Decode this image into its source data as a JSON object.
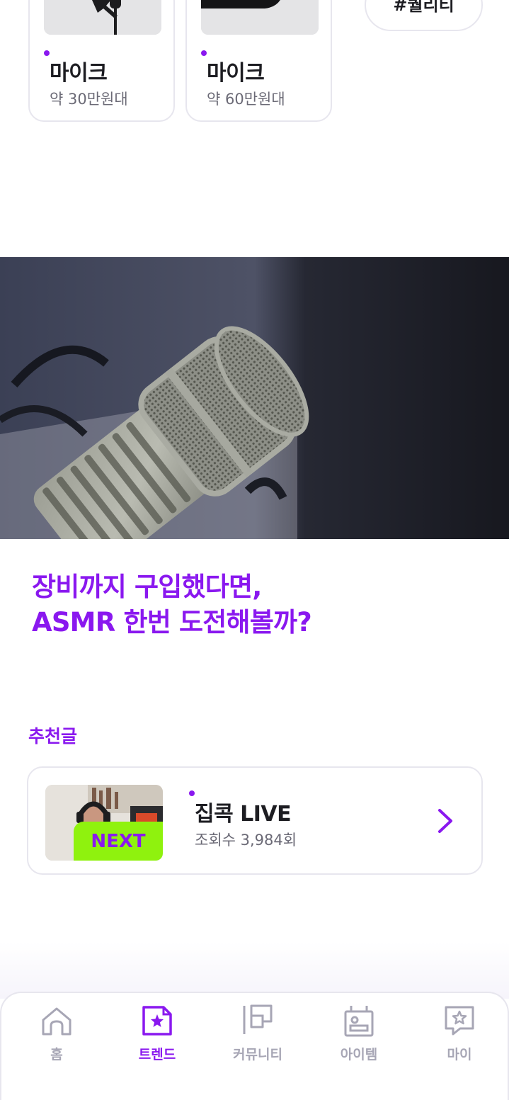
{
  "products": [
    {
      "name": "마이크",
      "price": "약 30만원대"
    },
    {
      "name": "마이크",
      "price": "약 60만원대"
    }
  ],
  "tag_chip": "#퀄리티",
  "hero": {
    "title_line1": "장비까지 구입했다면,",
    "title_line2": "ASMR 한번 도전해볼까?"
  },
  "recommended": {
    "section_label": "추천글",
    "badge": "NEXT",
    "title": "집콕 LIVE",
    "views": "조회수 3,984회"
  },
  "nav": {
    "items": [
      {
        "label": "홈",
        "icon": "home-icon"
      },
      {
        "label": "트렌드",
        "icon": "trend-icon"
      },
      {
        "label": "커뮤니티",
        "icon": "community-icon"
      },
      {
        "label": "아이템",
        "icon": "item-icon"
      },
      {
        "label": "마이",
        "icon": "my-icon"
      }
    ],
    "active": "트렌드"
  },
  "colors": {
    "accent": "#8a18ef",
    "badge": "#8ff20e",
    "nav_inactive": "#a7a6b5",
    "border": "#e7e6ee"
  }
}
